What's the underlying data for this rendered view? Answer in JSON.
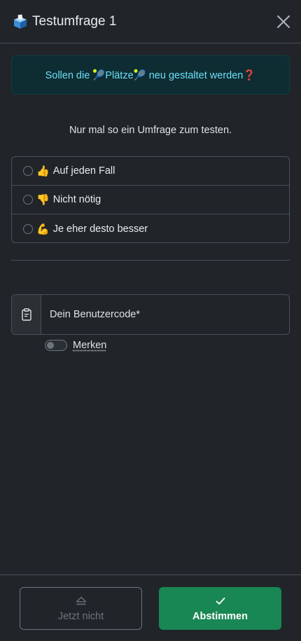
{
  "modal": {
    "title": "Testumfrage 1",
    "title_icon": "ballot-box-icon",
    "close_icon": "close-icon"
  },
  "question": {
    "text": "Sollen die 🎾Plätze🎾 neu gestaltet werden❓"
  },
  "description": "Nur mal so ein Umfrage zum testen.",
  "options": [
    {
      "emoji": "👍",
      "label": "Auf jeden Fall"
    },
    {
      "emoji": "👎",
      "label": "Nicht nötig"
    },
    {
      "emoji": "💪",
      "label": "Je eher desto besser"
    }
  ],
  "user_code": {
    "placeholder": "Dein Benutzercode*",
    "value": "",
    "icon": "clipboard-icon"
  },
  "remember": {
    "label": "Merken",
    "checked": false
  },
  "footer": {
    "skip_label": "Jetzt nicht",
    "skip_icon": "eject-icon",
    "vote_label": "Abstimmen",
    "vote_icon": "check-icon"
  },
  "colors": {
    "background": "#212529",
    "info": "#6edff6",
    "success": "#198754",
    "border": "#495057"
  }
}
